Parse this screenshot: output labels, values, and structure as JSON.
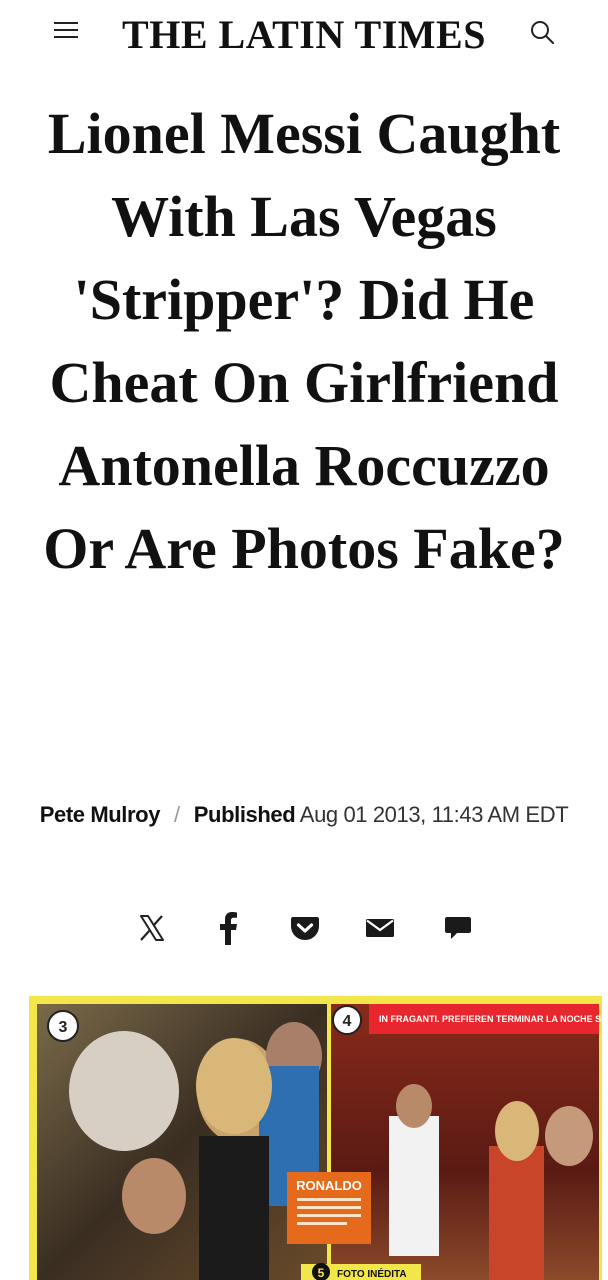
{
  "header": {
    "site_name": "THE LATIN TIMES",
    "menu_icon": "hamburger-menu-icon",
    "search_icon": "search-icon"
  },
  "article": {
    "title": "Lionel Messi Caught With Las Vegas 'Stripper'? Did He Cheat On Girlfriend Antonella Roccuzzo Or Are Photos Fake?",
    "author": "Pete Mulroy",
    "separator": "/",
    "published_label": "Published",
    "published_date": "Aug 01 2013, 11:43 AM EDT"
  },
  "share": {
    "icons": [
      "x-icon",
      "facebook-icon",
      "pocket-icon",
      "email-icon",
      "comment-icon"
    ]
  },
  "hero_image": {
    "labels": {
      "num_left": "3",
      "num_right": "4",
      "caption_name": "RONALDO",
      "num_bottom": "5",
      "bottom_banner": "FOTO INÉDITA",
      "top_banner": "IN FRAGANTI. PREFIEREN TERMINAR LA NOCHE SOLO"
    },
    "colors": {
      "frame": "#f3e64a",
      "accent": "#e8262d",
      "caption_bg": "#e56a1c"
    }
  }
}
